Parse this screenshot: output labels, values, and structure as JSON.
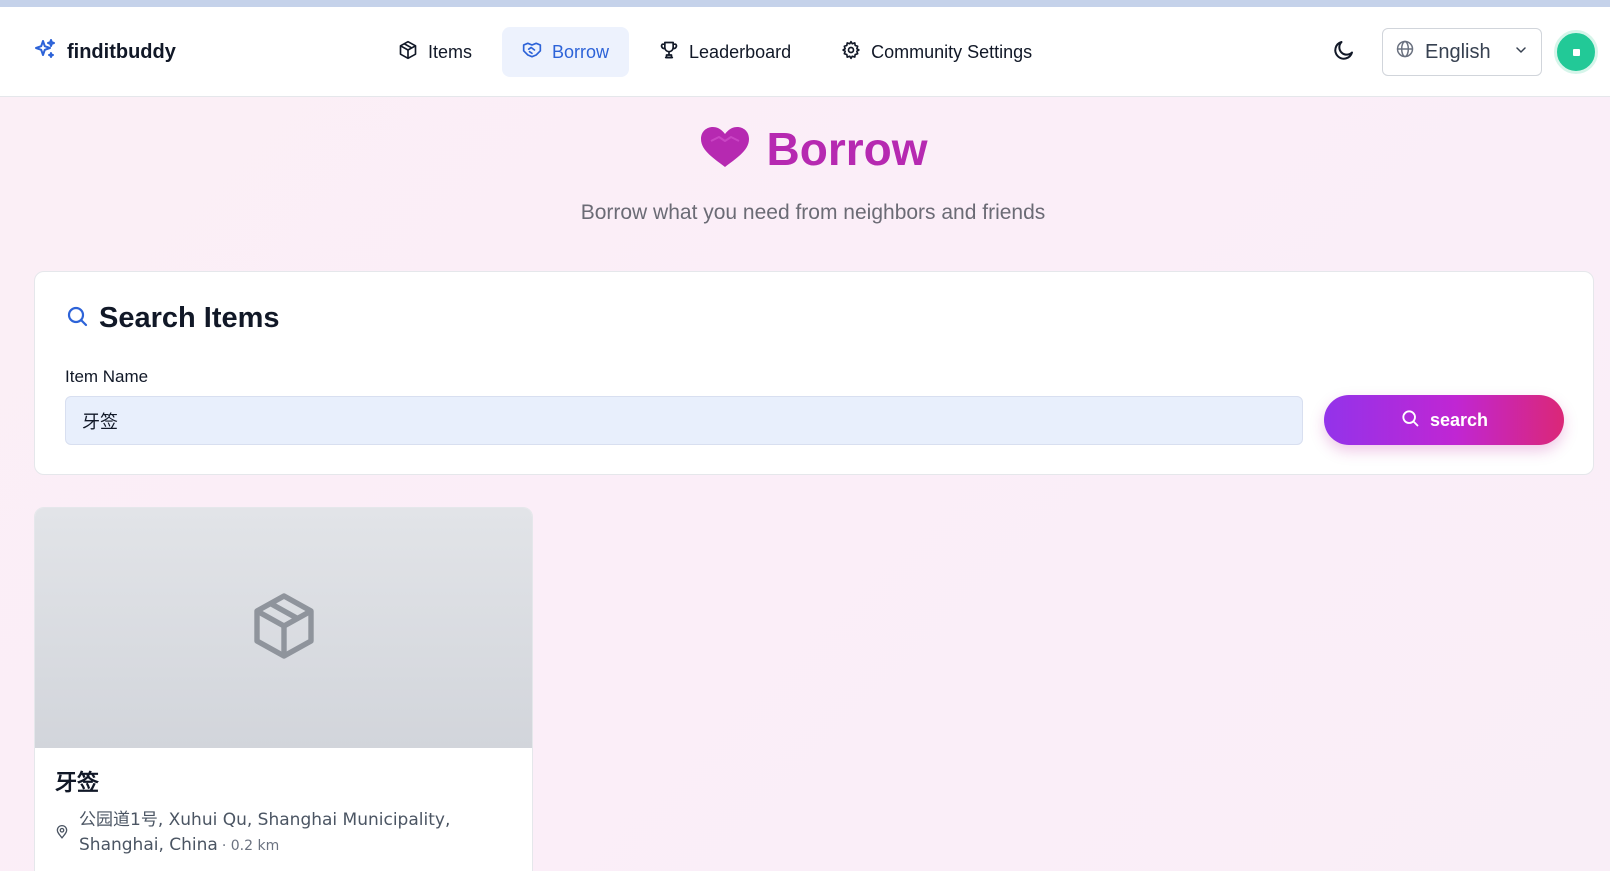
{
  "header": {
    "brand": "finditbuddy",
    "nav": [
      {
        "label": "Items",
        "icon": "box-icon",
        "active": false
      },
      {
        "label": "Borrow",
        "icon": "handshake-icon",
        "active": true
      },
      {
        "label": "Leaderboard",
        "icon": "trophy-icon",
        "active": false
      },
      {
        "label": "Community Settings",
        "icon": "gear-icon",
        "active": false
      }
    ],
    "language": "English"
  },
  "hero": {
    "title": "Borrow",
    "subtitle": "Borrow what you need from neighbors and friends"
  },
  "search": {
    "title": "Search Items",
    "field_label": "Item Name",
    "value": "牙签",
    "button_label": "search"
  },
  "results": [
    {
      "name": "牙签",
      "address": "公园道1号, Xuhui Qu, Shanghai Municipality, Shanghai, China",
      "distance": "· 0.2 km"
    }
  ],
  "colors": {
    "accent_blue": "#2d63d8",
    "brand_magenta": "#b629b1",
    "avatar_green": "#22c997"
  }
}
